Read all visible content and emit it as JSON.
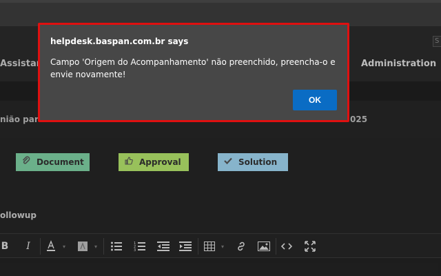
{
  "dialog": {
    "title": "helpdesk.baspan.com.br says",
    "message": "Campo 'Origem do Acompanhamento' não preenchido, preencha-o e envie novamente!",
    "ok_label": "OK"
  },
  "nav": {
    "assist_label": "Assistan",
    "admin_label": "Administration",
    "search_text": "S"
  },
  "ticket": {
    "title_fragment": "nião par",
    "year_fragment": "025"
  },
  "actions": {
    "document_label": "Document",
    "approval_label": "Approval",
    "solution_label": "Solution"
  },
  "followup": {
    "label": "ollowup"
  },
  "colors": {
    "dialog_border": "#e01010",
    "ok_button": "#0a6cc4",
    "document_bg": "#7ecfa3",
    "approval_bg": "#b3e36b",
    "solution_bg": "#9fd4ef"
  },
  "icons": {
    "document": "paperclip-icon",
    "approval": "thumbs-up-icon",
    "solution": "check-icon"
  }
}
